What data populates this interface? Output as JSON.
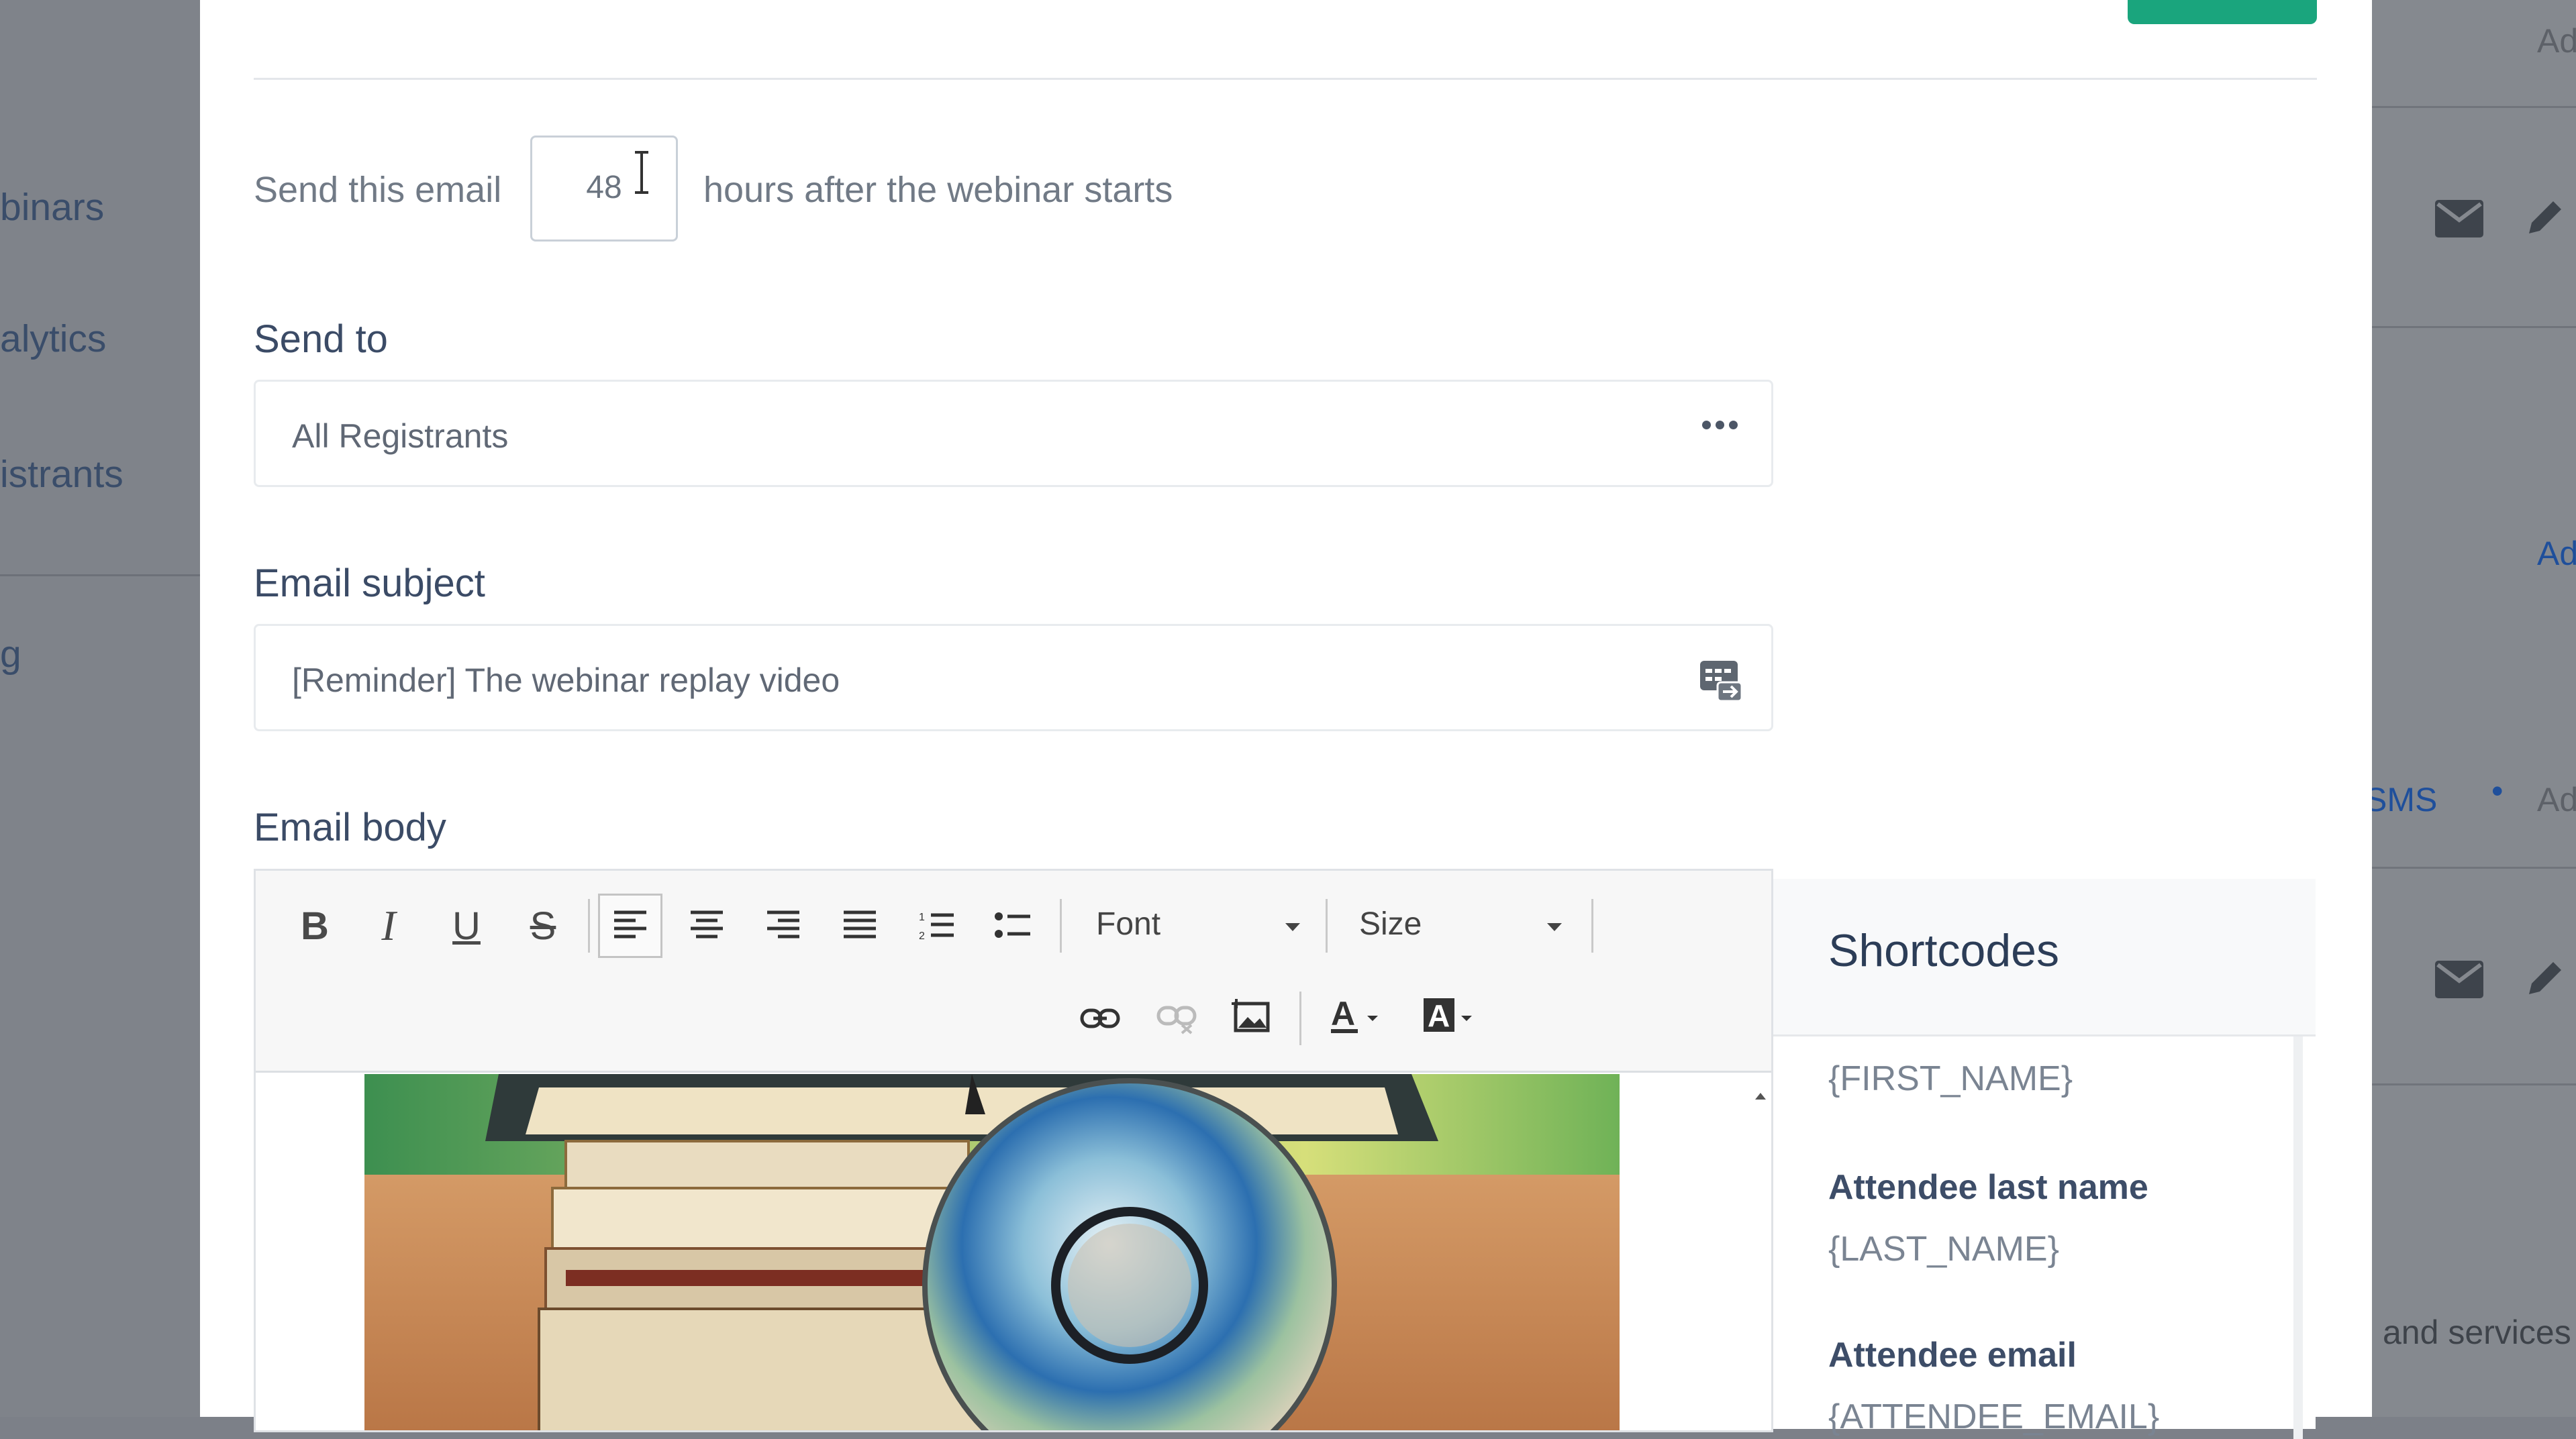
{
  "background": {
    "sidebar_items": [
      "binars",
      "alytics",
      "istrants",
      "g"
    ],
    "right_links": [
      "Ad",
      "Ad",
      "SMS",
      "Ad",
      "and services"
    ]
  },
  "modal": {
    "schedule": {
      "prefix": "Send this email",
      "hours_value": "48",
      "suffix": "hours after the webinar starts"
    },
    "send_to": {
      "label": "Send to",
      "value": "All Registrants"
    },
    "email_subject": {
      "label": "Email subject",
      "value": "[Reminder] The webinar replay video"
    },
    "email_body": {
      "label": "Email body",
      "toolbar": {
        "font_label": "Font",
        "size_label": "Size"
      }
    },
    "shortcodes": {
      "title": "Shortcodes",
      "items": [
        {
          "name": "",
          "code": "{FIRST_NAME}"
        },
        {
          "name": "Attendee last name",
          "code": "{LAST_NAME}"
        },
        {
          "name": "Attendee email",
          "code": "{ATTENDEE_EMAIL}"
        }
      ]
    }
  },
  "colors": {
    "accent": "#1aa57d",
    "heading": "#3b4b66",
    "overlay": "#7f838a"
  }
}
